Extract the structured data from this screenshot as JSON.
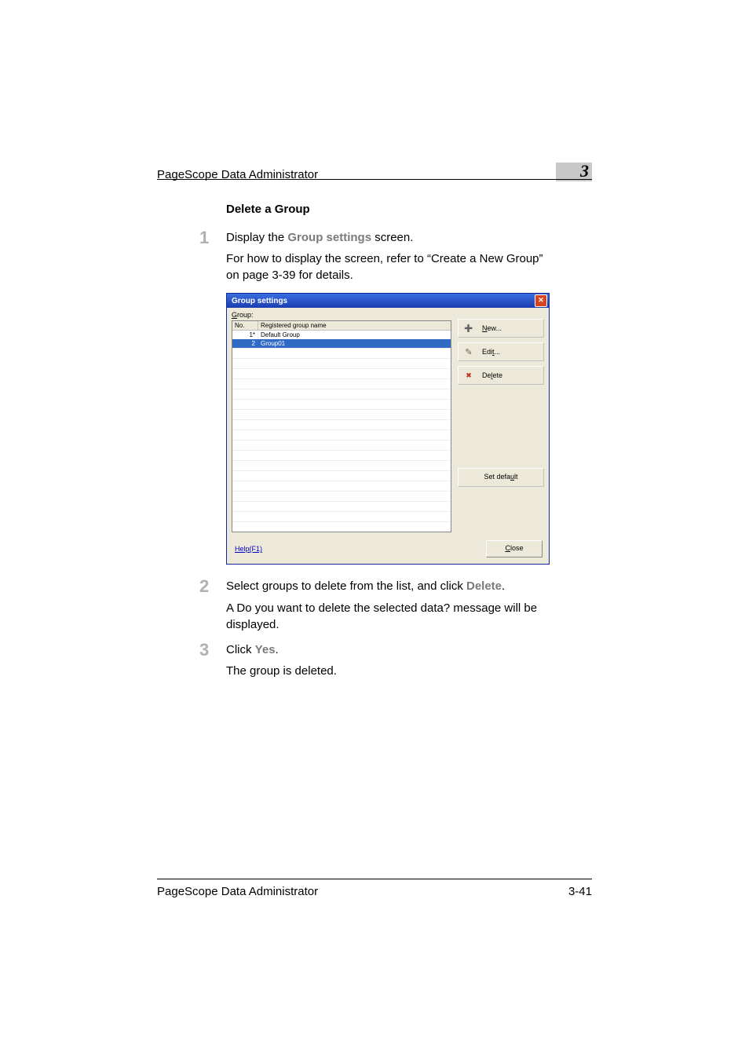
{
  "header": {
    "title": "PageScope Data Administrator",
    "chapter": "3"
  },
  "section_title": "Delete a Group",
  "steps": [
    {
      "num": "1",
      "line": "Display the ",
      "em": "Group settings",
      "line_tail": " screen.",
      "para": "For how to display the screen, refer to “Create a New Group” on page 3-39 for details."
    },
    {
      "num": "2",
      "line": "Select groups to delete from the list, and click ",
      "em": "Delete",
      "line_tail": ".",
      "para_pre": "A ",
      "para_em": "Do you want to delete the selected data?",
      "para_post": " message will be displayed."
    },
    {
      "num": "3",
      "line": "Click ",
      "em": "Yes",
      "line_tail": ".",
      "para": "The group is deleted."
    }
  ],
  "dialog": {
    "title": "Group settings",
    "group_label_pre": "G",
    "group_label_post": "roup:",
    "columns": {
      "no": "No.",
      "name": "Registered group name"
    },
    "rows": [
      {
        "no": "1*",
        "name": "Default Group",
        "selected": false
      },
      {
        "no": "2",
        "name": "Group01",
        "selected": true
      }
    ],
    "buttons": {
      "new": {
        "pre": "N",
        "post": "ew..."
      },
      "edit": {
        "pre": "Edi",
        "u": "t",
        "post": "..."
      },
      "delete": {
        "pre": "De",
        "u": "l",
        "post": "ete"
      },
      "setdefault": {
        "pre": "Set defa",
        "u": "u",
        "post": "lt"
      },
      "close": {
        "u": "C",
        "post": "lose"
      }
    },
    "help": "Help(F1)"
  },
  "footer": {
    "title": "PageScope Data Administrator",
    "pageno": "3-41"
  }
}
